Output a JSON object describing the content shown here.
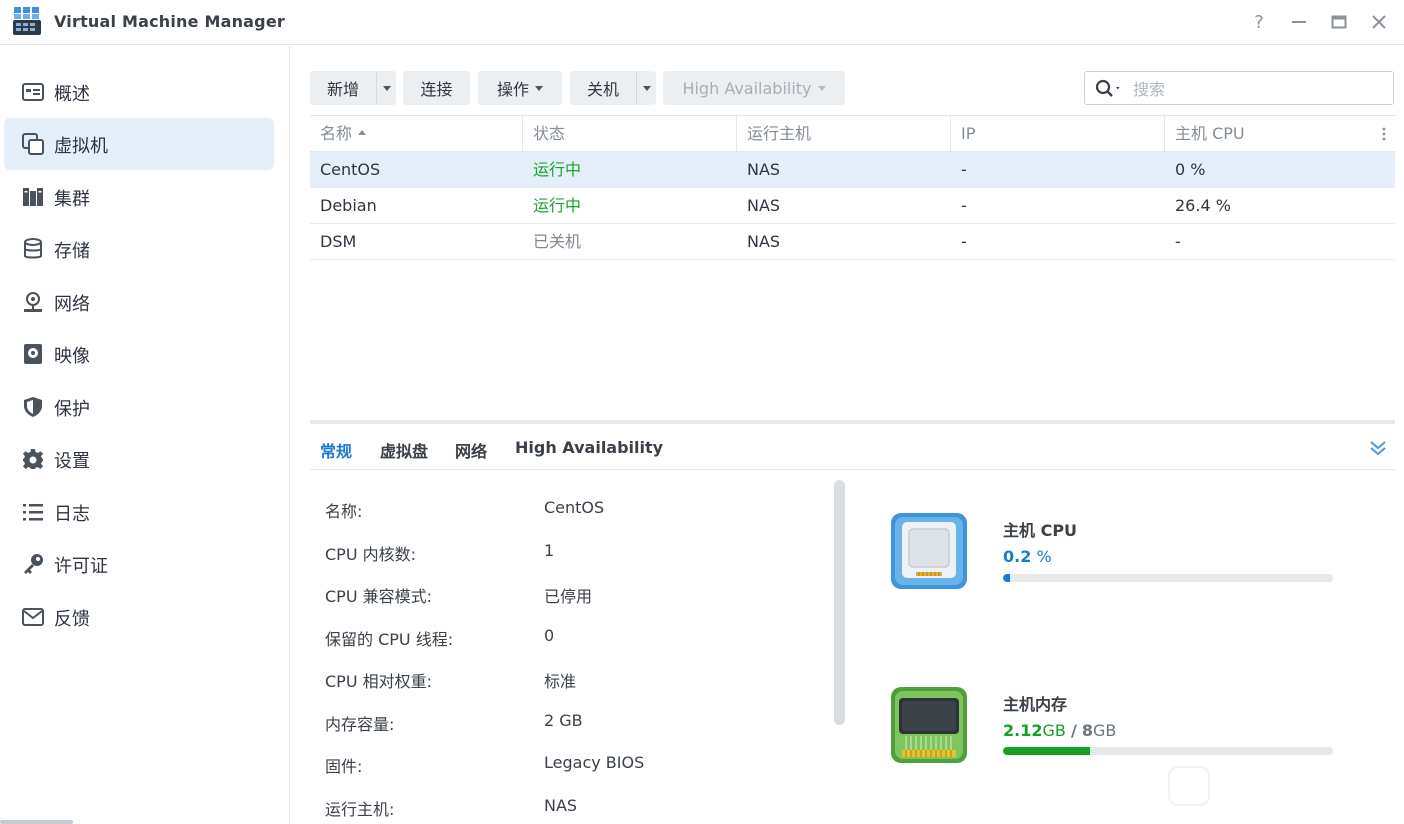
{
  "window": {
    "title": "Virtual Machine Manager",
    "help_label": "?"
  },
  "sidebar": {
    "items": [
      {
        "label": "概述",
        "icon": "overview-icon",
        "active": false
      },
      {
        "label": "虚拟机",
        "icon": "virtual-machine-icon",
        "active": true
      },
      {
        "label": "集群",
        "icon": "cluster-icon",
        "active": false
      },
      {
        "label": "存储",
        "icon": "storage-icon",
        "active": false
      },
      {
        "label": "网络",
        "icon": "network-icon",
        "active": false
      },
      {
        "label": "映像",
        "icon": "image-icon",
        "active": false
      },
      {
        "label": "保护",
        "icon": "shield-icon",
        "active": false
      },
      {
        "label": "设置",
        "icon": "gear-icon",
        "active": false
      },
      {
        "label": "日志",
        "icon": "list-icon",
        "active": false
      },
      {
        "label": "许可证",
        "icon": "key-icon",
        "active": false
      },
      {
        "label": "反馈",
        "icon": "mail-icon",
        "active": false
      }
    ]
  },
  "toolbar": {
    "add_label": "新增",
    "connect_label": "连接",
    "action_label": "操作",
    "shutdown_label": "关机",
    "ha_label": "High Availability"
  },
  "search": {
    "placeholder": "搜索",
    "value": ""
  },
  "table": {
    "columns": [
      "名称",
      "状态",
      "运行主机",
      "IP",
      "主机 CPU"
    ],
    "rows": [
      {
        "name": "CentOS",
        "status": "运行中",
        "host": "NAS",
        "ip": "-",
        "cpu": "0 %",
        "running": true,
        "selected": true
      },
      {
        "name": "Debian",
        "status": "运行中",
        "host": "NAS",
        "ip": "-",
        "cpu": "26.4 %",
        "running": true,
        "selected": false
      },
      {
        "name": "DSM",
        "status": "已关机",
        "host": "NAS",
        "ip": "-",
        "cpu": "-",
        "running": false,
        "selected": false
      }
    ]
  },
  "detail_tabs": [
    "常规",
    "虚拟盘",
    "网络",
    "High Availability"
  ],
  "details": [
    {
      "label": "名称:",
      "value": "CentOS"
    },
    {
      "label": "CPU 内核数:",
      "value": "1"
    },
    {
      "label": "CPU 兼容模式:",
      "value": "已停用"
    },
    {
      "label": "保留的 CPU 线程:",
      "value": "0"
    },
    {
      "label": "CPU 相对权重:",
      "value": "标准"
    },
    {
      "label": "内存容量:",
      "value": "2 GB"
    },
    {
      "label": "固件:",
      "value": "Legacy BIOS"
    },
    {
      "label": "运行主机:",
      "value": "NAS"
    }
  ],
  "resources": {
    "cpu": {
      "title": "主机 CPU",
      "value": "0.2",
      "unit": "%",
      "fraction": 0.02,
      "color": "#1b7ad1"
    },
    "memory": {
      "title": "主机内存",
      "used": "2.12",
      "used_unit": "GB",
      "separator": "/",
      "total": "8",
      "total_unit": "GB",
      "fraction": 0.265,
      "color": "#15a025"
    }
  },
  "colors": {
    "accent": "#1b7ad1",
    "running": "#1aa32e",
    "selected_bg": "#e4eff9"
  }
}
